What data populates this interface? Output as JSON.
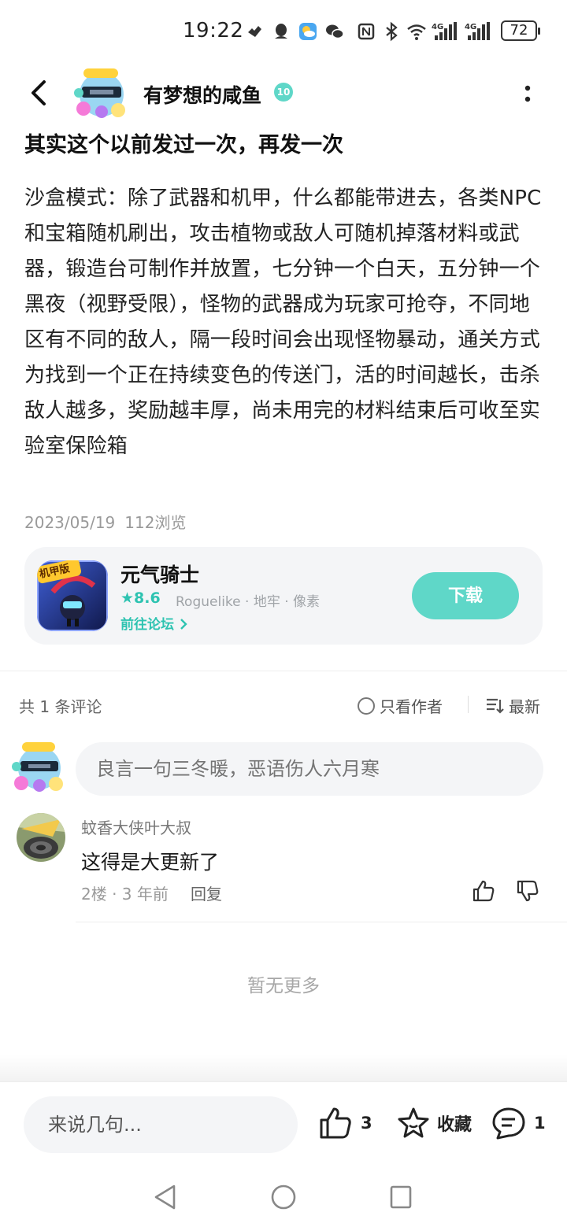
{
  "status_bar": {
    "time": "19:22",
    "battery": "72",
    "icons": [
      "tiktok-icon",
      "qq-icon",
      "weather-icon",
      "wechat-icon",
      "nfc-icon",
      "bluetooth-icon",
      "wifi-icon",
      "signal-4g-icon",
      "signal-4g-icon",
      "battery-icon"
    ]
  },
  "header": {
    "author_name": "有梦想的咸鱼",
    "level": "10"
  },
  "post": {
    "title": "其实这个以前发过一次，再发一次",
    "body": "沙盒模式：除了武器和机甲，什么都能带进去，各类NPC和宝箱随机刷出，攻击植物或敌人可随机掉落材料或武器，锻造台可制作并放置，七分钟一个白天，五分钟一个黑夜（视野受限），怪物的武器成为玩家可抢夺，不同地区有不同的敌人，隔一段时间会出现怪物暴动，通关方式为找到一个正在持续变色的传送门，活的时间越长，击杀敌人越多，奖励越丰厚，尚未用完的材料结束后可收至实验室保险箱",
    "date": "2023/05/19",
    "views": "112浏览"
  },
  "game_card": {
    "icon_badge": "机甲版",
    "name": "元气骑士",
    "score": "★8.6",
    "tags": "Roguelike · 地牢 · 像素",
    "forum_link": "前往论坛",
    "download_label": "下载"
  },
  "comments": {
    "count_label": "共 1 条评论",
    "author_only_label": "只看作者",
    "sort_label": "最新",
    "input_placeholder": "良言一句三冬暖，恶语伤人六月寒",
    "items": [
      {
        "author": "蚊香大侠叶大叔",
        "text": "这得是大更新了",
        "meta": "2楼 · 3 年前",
        "reply_label": "回复"
      }
    ],
    "no_more": "暂无更多"
  },
  "bottom_bar": {
    "say_placeholder": "来说几句...",
    "like_count": "3",
    "favorite_label": "收藏",
    "comment_count": "1"
  },
  "colors": {
    "accent": "#5fd7c8",
    "accent_text": "#2ec3b1",
    "card_bg": "#f4f5f7"
  }
}
